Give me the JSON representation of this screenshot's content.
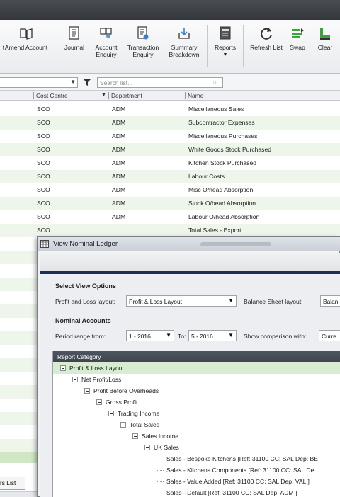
{
  "ribbon": {
    "items": [
      {
        "label": "t",
        "icon": "nominal-icon"
      },
      {
        "label": "Amend",
        "icon": "amend-icon"
      },
      {
        "label": "Account",
        "icon": "account-icon"
      },
      {
        "label": "Journal",
        "icon": "journal-icon"
      },
      {
        "label": "Account\nEnquiry",
        "icon": "account-enquiry-icon"
      },
      {
        "label": "Transaction\nEnquiry",
        "icon": "transaction-enquiry-icon"
      },
      {
        "label": "Summary\nBreakdown",
        "icon": "summary-breakdown-icon"
      },
      {
        "label": "Reports",
        "icon": "reports-icon"
      },
      {
        "label": "Refresh List",
        "icon": "refresh-icon"
      },
      {
        "label": "Swap",
        "icon": "swap-icon"
      },
      {
        "label": "Clear",
        "icon": "clear-icon"
      }
    ],
    "accent_green": "#3aa53a"
  },
  "filter": {
    "combo_value": "",
    "search_placeholder": "Search list..."
  },
  "grid": {
    "headers": {
      "cost_centre": "Cost Centre",
      "department": "Department",
      "name": "Name"
    },
    "rows": [
      {
        "cc": "SCO",
        "dept": "ADM",
        "name": "Miscellaneous Sales"
      },
      {
        "cc": "SCO",
        "dept": "ADM",
        "name": "Subcontractor Expenses"
      },
      {
        "cc": "SCO",
        "dept": "ADM",
        "name": "Miscellaneous Purchases"
      },
      {
        "cc": "SCO",
        "dept": "ADM",
        "name": "White Goods Stock Purchased"
      },
      {
        "cc": "SCO",
        "dept": "ADM",
        "name": "Kitchen Stock Purchased"
      },
      {
        "cc": "SCO",
        "dept": "ADM",
        "name": "Labour Costs"
      },
      {
        "cc": "SCO",
        "dept": "ADM",
        "name": "Misc O/head Absorption"
      },
      {
        "cc": "SCO",
        "dept": "ADM",
        "name": "Stock O/head Absorption"
      },
      {
        "cc": "SCO",
        "dept": "ADM",
        "name": "Labour O/head Absorption"
      },
      {
        "cc": "SCO",
        "dept": "",
        "name": "Total Sales - Export"
      }
    ],
    "bottom_tab": "rs List"
  },
  "dialog": {
    "title": "View Nominal Ledger",
    "select_view_options": "Select View Options",
    "pl_layout_label": "Profit and Loss layout:",
    "pl_layout_value": "Profit & Loss Layout",
    "bs_layout_label": "Balance Sheet layout:",
    "bs_layout_value": "Balan",
    "nominal_accounts": "Nominal Accounts",
    "period_from_label": "Period range from:",
    "period_from_value": "1 - 2016",
    "to_label": "To:",
    "period_to_value": "5 - 2016",
    "comparison_label": "Show comparison with:",
    "comparison_value": "Curre",
    "tree_header": "Report Category",
    "tree": [
      {
        "label": "Profit & Loss Layout",
        "level": 0,
        "expander": true,
        "selected": true
      },
      {
        "label": "Net Profit/Loss",
        "level": 1,
        "expander": true
      },
      {
        "label": "Profit Before Overheads",
        "level": 2,
        "expander": true
      },
      {
        "label": "Gross Profit",
        "level": 3,
        "expander": true
      },
      {
        "label": "Trading Income",
        "level": 4,
        "expander": true
      },
      {
        "label": "Total Sales",
        "level": 5,
        "expander": true
      },
      {
        "label": "Sales Income",
        "level": 6,
        "expander": true
      },
      {
        "label": "UK Sales",
        "level": 7,
        "expander": true
      },
      {
        "label": "Sales - Bespoke Kitchens [Ref: 31100 CC: SAL Dep: BE",
        "level": 8,
        "expander": false
      },
      {
        "label": "Sales - Kitchens Components [Ref: 31100 CC: SAL De",
        "level": 8,
        "expander": false
      },
      {
        "label": "Sales - Value Added [Ref: 31100 CC: SAL Dep: VAL ]",
        "level": 8,
        "expander": false
      },
      {
        "label": "Sales - Default [Ref: 31100 CC: SAL Dep: ADM ]",
        "level": 8,
        "expander": false
      }
    ]
  }
}
